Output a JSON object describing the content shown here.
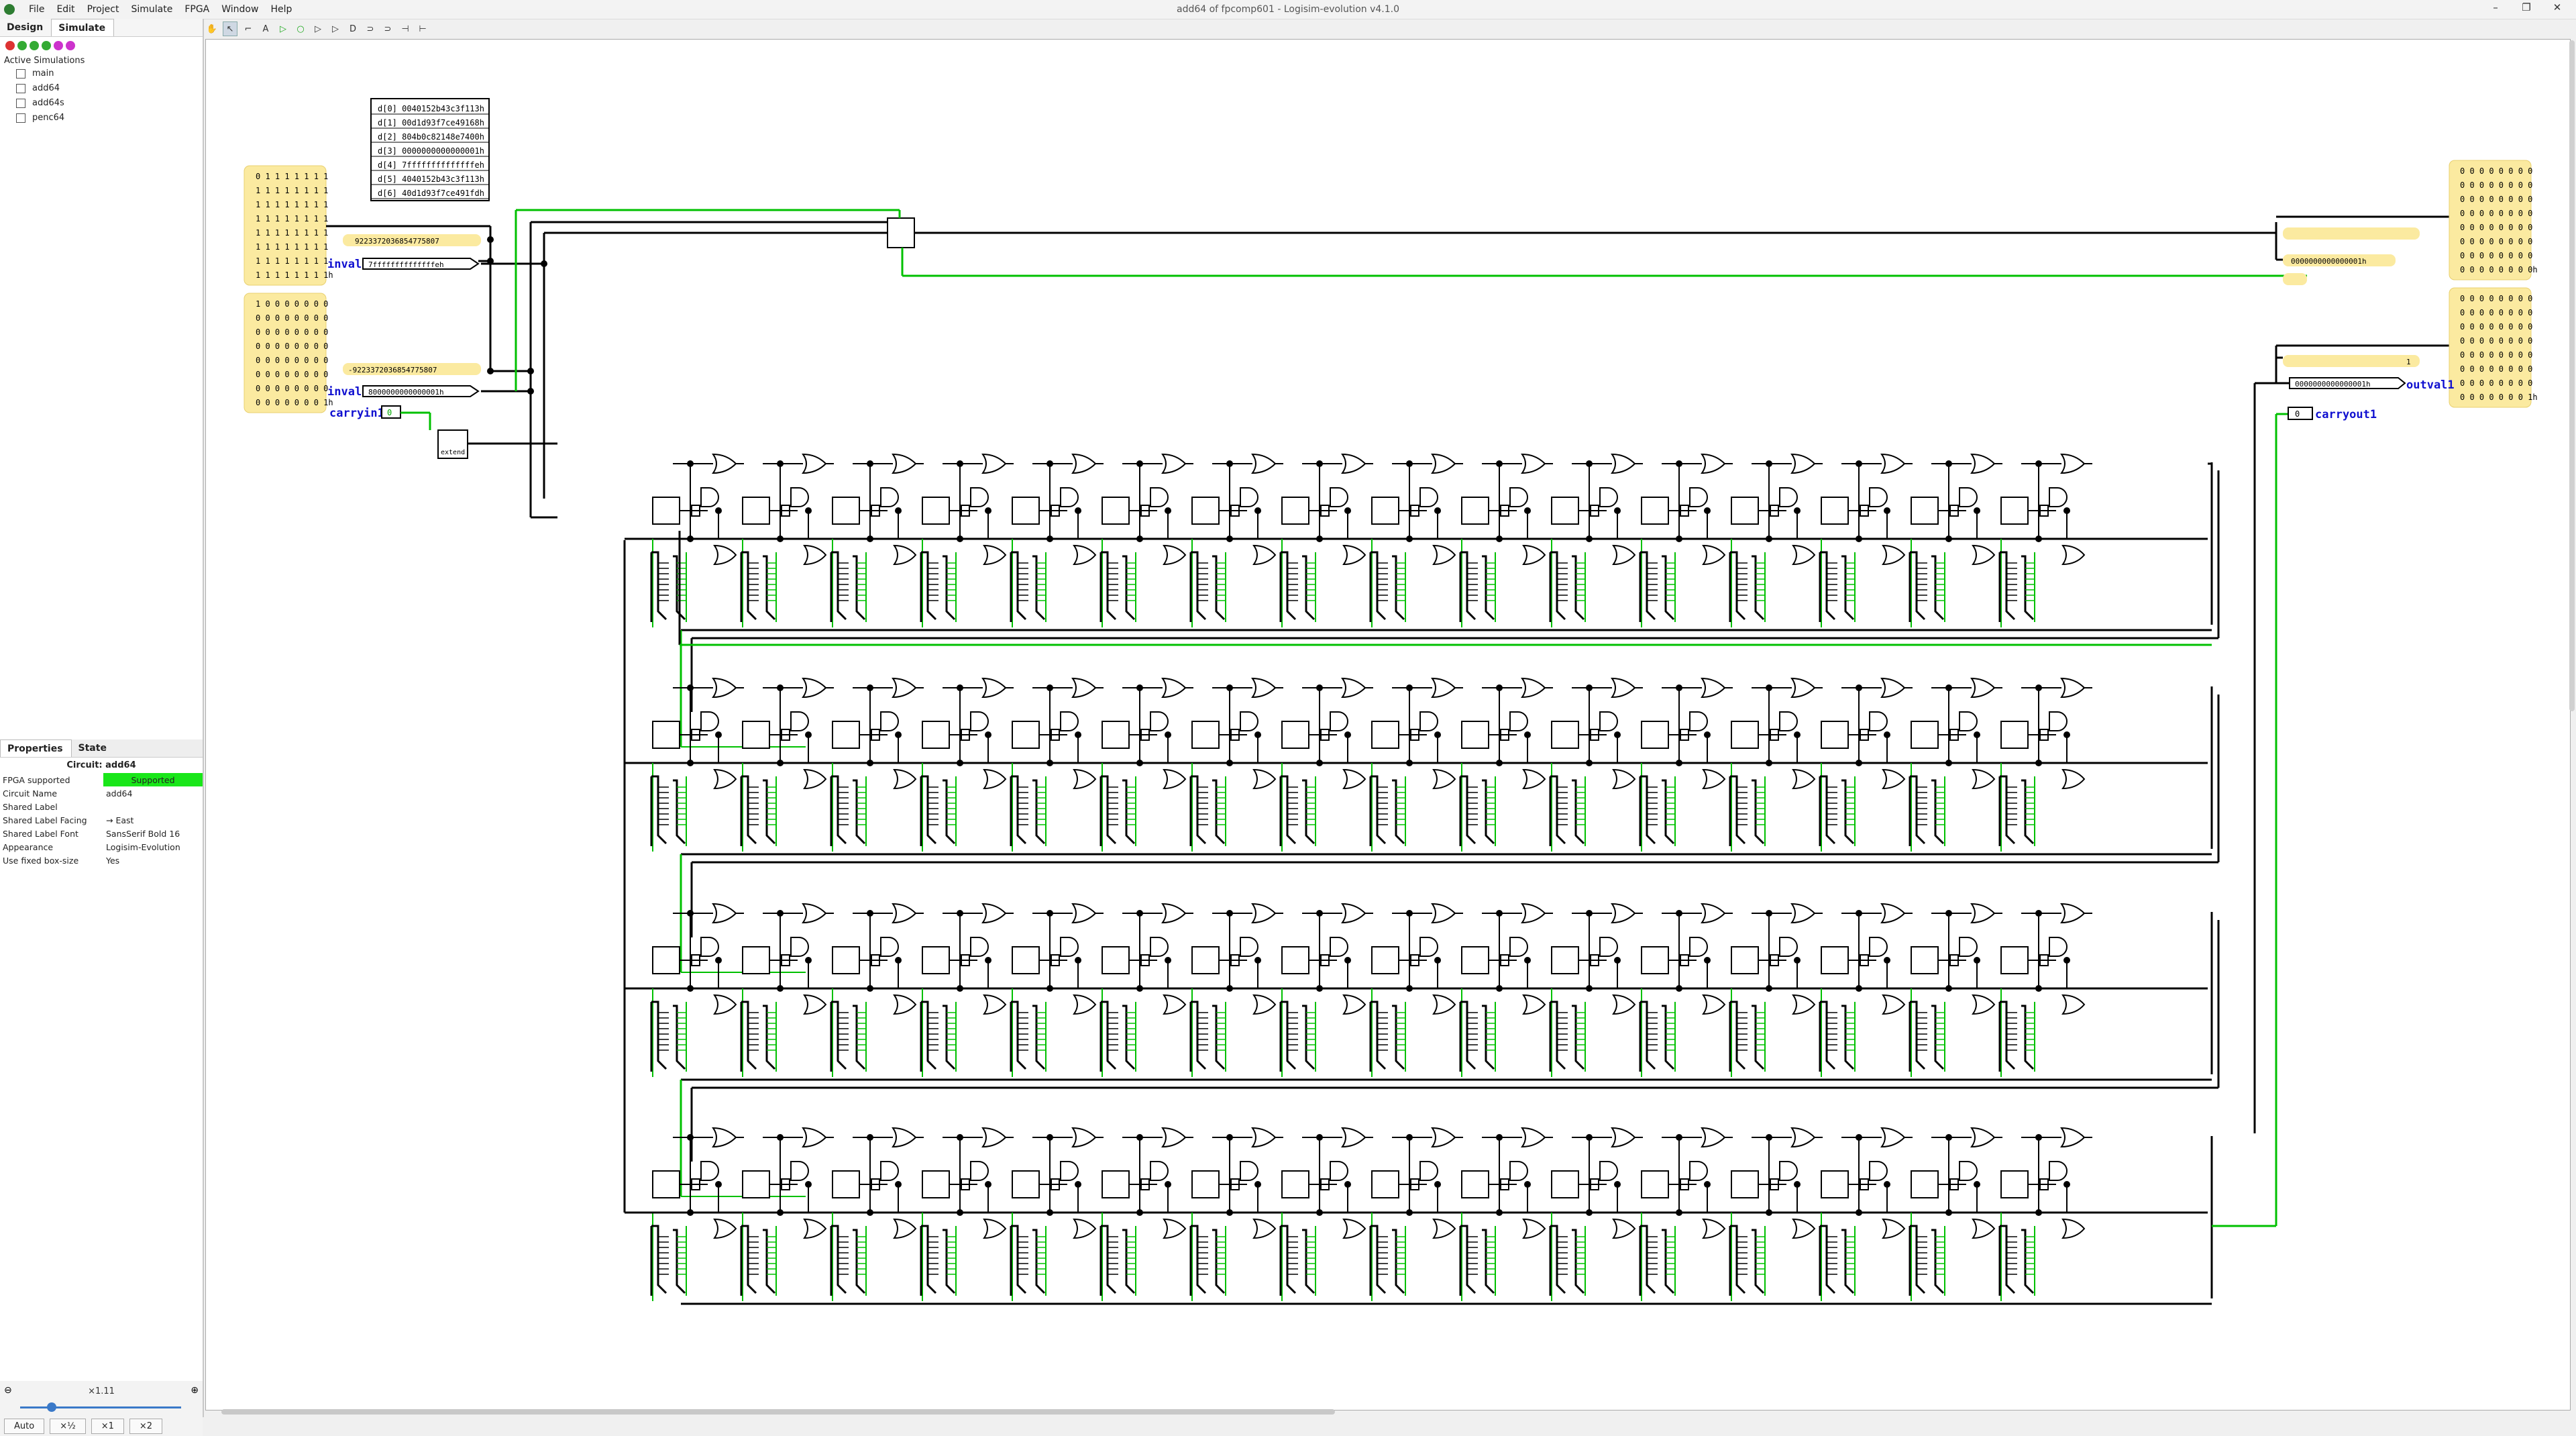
{
  "window": {
    "title": "add64 of fpcomp601 - Logisim-evolution v4.1.0",
    "menu": [
      "File",
      "Edit",
      "Project",
      "Simulate",
      "FPGA",
      "Window",
      "Help"
    ],
    "controls": [
      "–",
      "❐",
      "✕"
    ]
  },
  "toolbar": {
    "tools": [
      "hand-icon",
      "pointer-icon",
      "wiring-icon",
      "text-icon",
      "input-pin-icon",
      "output-pin-icon",
      "not-gate-icon",
      "buffer-icon",
      "and-gate-icon",
      "or-gate-icon",
      "xor-gate-icon",
      "sim-step-icon",
      "sim-tick-icon"
    ]
  },
  "left": {
    "tabs": [
      "Design",
      "Simulate"
    ],
    "active_simulations_label": "Active Simulations",
    "simulations": [
      "main",
      "add64",
      "add64s",
      "penc64"
    ]
  },
  "properties": {
    "tabs": [
      "Properties",
      "State"
    ],
    "title": "Circuit: add64",
    "rows": [
      {
        "k": "FPGA supported",
        "v": "Supported"
      },
      {
        "k": "Circuit Name",
        "v": "add64"
      },
      {
        "k": "Shared Label",
        "v": ""
      },
      {
        "k": "Shared Label Facing",
        "v": "→ East"
      },
      {
        "k": "Shared Label Font",
        "v": "SansSerif Bold 16"
      },
      {
        "k": "Appearance",
        "v": "Logisim-Evolution"
      },
      {
        "k": "Use fixed box-size",
        "v": "Yes"
      }
    ]
  },
  "zoom": {
    "value": "×1.11",
    "buttons": [
      "Auto",
      "×½",
      "×1",
      "×2"
    ]
  },
  "canvas": {
    "rom_values": [
      "0040152b43c3f113h",
      "00d1d93f7ce49168h",
      "804b0c82148e7400h",
      "0000000000000001h",
      "7ffffffffffffffeh",
      "4040152b43c3f113h",
      "40d1d93f7ce491fdh"
    ],
    "inval1": {
      "label": "inval1",
      "hex": "7ffffffffffffffeh",
      "dec": "9223372036854775807"
    },
    "inval2": {
      "label": "inval2",
      "hex": "8000000000000001h",
      "dec": "-9223372036854775807"
    },
    "carryin": {
      "label": "carryin1",
      "value": "0"
    },
    "extend_label": "extend",
    "probe_bits_1": [
      "0 1 1 1 1 1 1 1",
      "1 1 1 1 1 1 1 1",
      "1 1 1 1 1 1 1 1",
      "1 1 1 1 1 1 1 1",
      "1 1 1 1 1 1 1 1",
      "1 1 1 1 1 1 1 1",
      "1 1 1 1 1 1 1 1",
      "1 1 1 1 1 1 1 1h"
    ],
    "probe_bits_2": [
      "1 0 0 0 0 0 0 0",
      "0 0 0 0 0 0 0 0",
      "0 0 0 0 0 0 0 0",
      "0 0 0 0 0 0 0 0",
      "0 0 0 0 0 0 0 0",
      "0 0 0 0 0 0 0 0",
      "0 0 0 0 0 0 0 0",
      "0 0 0 0 0 0 0 1h"
    ],
    "out_bits_1": [
      "0 0 0 0 0 0 0 0",
      "0 0 0 0 0 0 0 0",
      "0 0 0 0 0 0 0 0",
      "0 0 0 0 0 0 0 0",
      "0 0 0 0 0 0 0 0",
      "0 0 0 0 0 0 0 0",
      "0 0 0 0 0 0 0 0",
      "0 0 0 0 0 0 0 0h"
    ],
    "out_bits_2": [
      "0 0 0 0 0 0 0 0",
      "0 0 0 0 0 0 0 0",
      "0 0 0 0 0 0 0 0",
      "0 0 0 0 0 0 0 0",
      "0 0 0 0 0 0 0 0",
      "0 0 0 0 0 0 0 0",
      "0 0 0 0 0 0 0 0",
      "0 0 0 0 0 0 0 1h"
    ],
    "outval": {
      "label": "outval1",
      "hex": "0000000000000001h",
      "dec": "1"
    },
    "right_probe_hex": "0000000000000001h",
    "right_probe_dec": "1",
    "carryout": {
      "label": "carryout1",
      "value": "0"
    },
    "colors": {
      "wire_on": "#00c000",
      "wire_off": "#000000",
      "probe_bg": "#fbeaa0",
      "label": "#1010d0"
    }
  }
}
